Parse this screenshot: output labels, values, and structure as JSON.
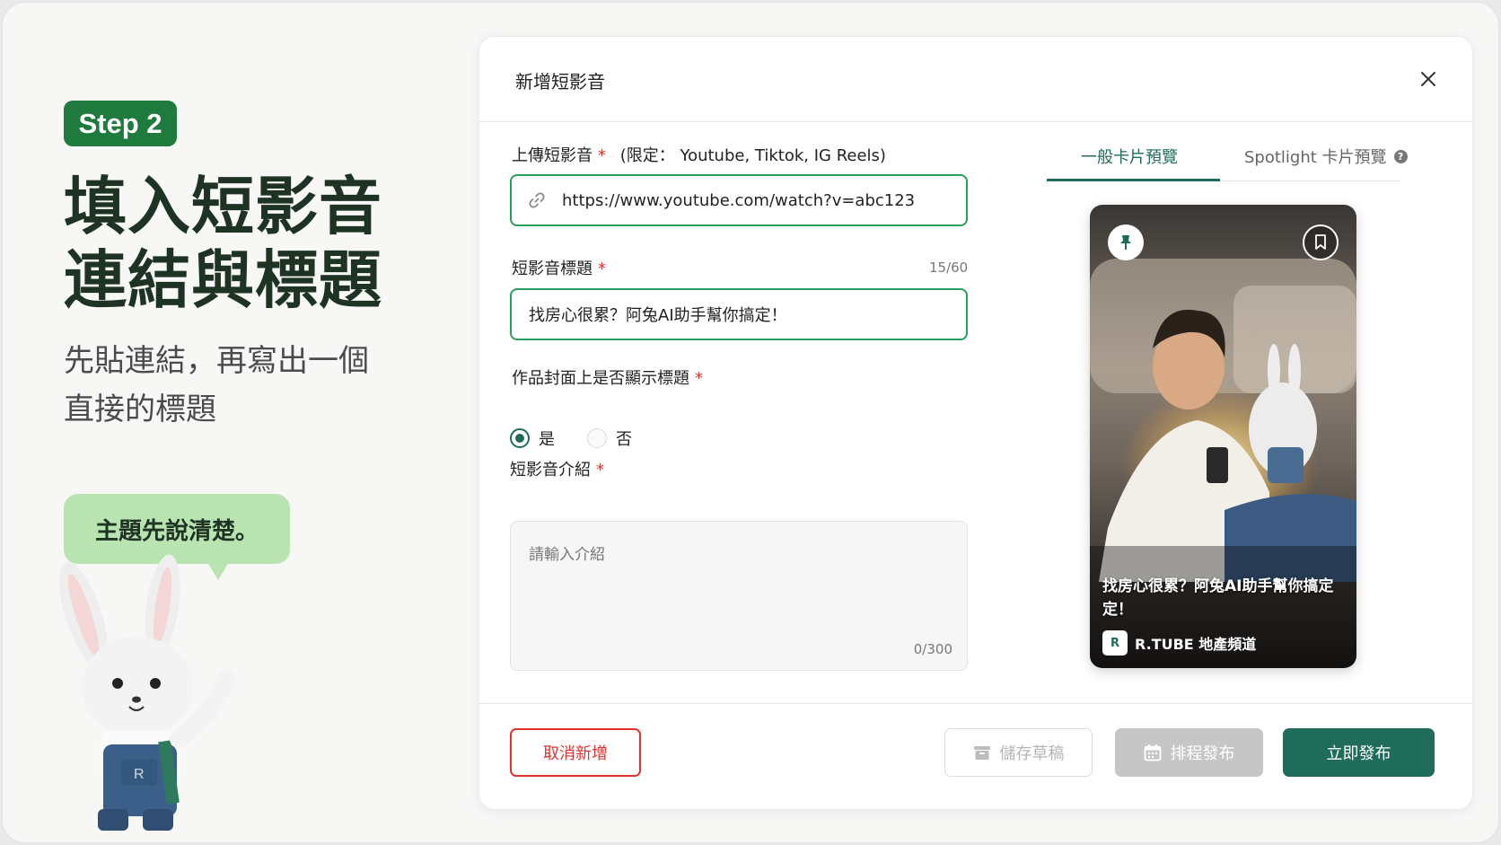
{
  "left_panel": {
    "step_label": "Step 2",
    "title_line1": "填入短影音",
    "title_line2": "連結與標題",
    "subtitle_line1": "先貼連結，再寫出一個",
    "subtitle_line2": "直接的標題",
    "bubble_text": "主題先說清楚。"
  },
  "modal": {
    "title": "新增短影音",
    "upload": {
      "label": "上傳短影音",
      "required_mark": "*",
      "hint": "(限定： Youtube, Tiktok, IG Reels)",
      "value": "https://www.youtube.com/watch?v=abc123"
    },
    "video_title": {
      "label": "短影音標題",
      "required_mark": "*",
      "counter": "15/60",
      "value": "找房心很累？阿兔AI助手幫你搞定！"
    },
    "show_title": {
      "label": "作品封面上是否顯示標題",
      "required_mark": "*",
      "options": [
        "是",
        "否"
      ],
      "selected": "是"
    },
    "intro": {
      "label": "短影音介紹",
      "required_mark": "*",
      "placeholder": "請輸入介紹",
      "counter": "0/300"
    },
    "tabs": {
      "general": "一般卡片預覽",
      "spotlight": "Spotlight 卡片預覽",
      "active": "general"
    },
    "preview": {
      "caption_line1": "找房心很累？阿兔AI助手幫你搞定",
      "caption_line2": "定！",
      "channel_logo": "R",
      "channel_name": "R.TUBE 地產頻道"
    },
    "footer": {
      "cancel": "取消新增",
      "save_draft": "儲存草稿",
      "schedule": "排程發布",
      "publish": "立即發布"
    }
  },
  "colors": {
    "brand_green": "#1f6c5b",
    "step_green": "#1f7a3e",
    "required_red": "#e0322e",
    "bubble_green": "#b9e4b1"
  }
}
